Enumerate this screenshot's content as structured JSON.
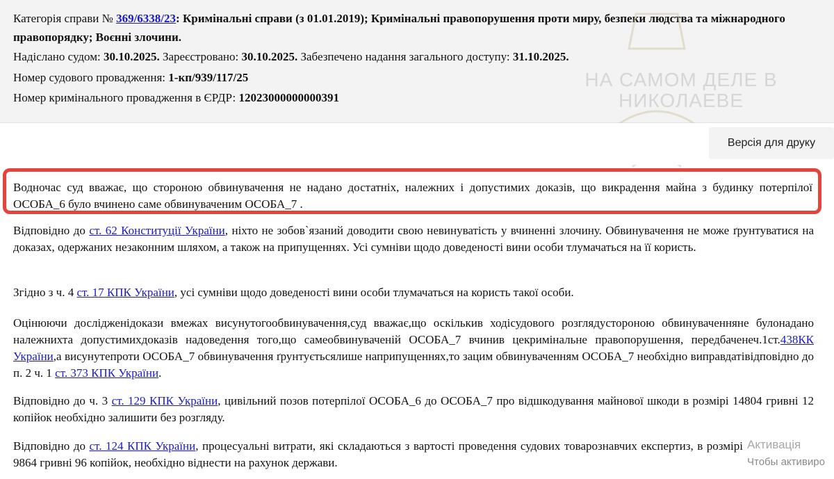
{
  "info": {
    "category_label": "Категорія справи № ",
    "case_number": "369/6338/23",
    "category_text_1": ": Кримінальні справи (з 01.01.2019); Кримінальні правопорушення проти миру, безпеки людства та міжнародного",
    "category_text_2": "правопорядку; Воєнні злочини.",
    "sent_label": "Надіслано судом: ",
    "sent_date": "30.10.2025.",
    "registered_label": " Зареєстровано: ",
    "registered_date": "30.10.2025.",
    "access_label": " Забезпечено надання загального доступу: ",
    "access_date": "31.10.2025.",
    "proceeding_label": "Номер судового провадження: ",
    "proceeding_number": "1-кп/939/117/25",
    "erdr_label": "Номер кримінального провадження в ЄРДР: ",
    "erdr_number": "12023000000000391"
  },
  "watermark": {
    "line1": "НА САМОМ ДЕЛЕ В",
    "line2": "НИКОЛАЕВЕ"
  },
  "toolbar": {
    "print_label": "Версія для друку"
  },
  "document": {
    "p1": "Водночас суд вважає, що стороною обвинувачення не надано достатніх, належних і допустимих доказів, що викрадення майна з будинку потерпілої ОСОБА_6 було вчинено саме обвинуваченим ОСОБА_7 .",
    "p2_a": "Відповідно до ",
    "p2_link": "ст. 62 Конституції України",
    "p2_b": ", ніхто не зобов`язаний доводити свою невинуватість у вчиненні злочину. Обвинувачення не може ґрунтуватися на доказах, одержаних незаконним шляхом, а також на припущеннях. Усі сумніви щодо доведеності вини особи тлумачаться на її користь.",
    "p3_a": "Згідно з ч. 4 ",
    "p3_link": "ст. 17 КПК України",
    "p3_b": ", усі сумніви щодо доведеності вини особи тлумачаться на користь такої особи.",
    "p4_a": "Оцінюючи дослідженідокази вмежах висунутогообвинувачення,суд вважає,що оскількив ходісудового розглядустороною обвинуваченняне булонадано належнихта допустимихдоказів надоведення того,що самеобвинуваченій ОСОБА_7 вчинив цекримінальне правопорушення, передбаченеч.1ст.",
    "p4_link1": "438КК України",
    "p4_b": ",а висунутепроти ОСОБА_7 обвинувачення ґрунтуєтьсялише наприпущеннях,то зацим обвинуваченням ОСОБА_7 необхідно виправдатівідповідно до п. 2 ч. 1 ",
    "p4_link2": "ст. 373 КПК України",
    "p4_c": ".",
    "p5_a": "Відповідно до ч. 3 ",
    "p5_link": "ст. 129 КПК України",
    "p5_b": ", цивільний позов потерпілої ОСОБА_6 до ОСОБА_7 про відшкодування майнової шкоди в розмірі 14804 гривні 12 копійок необхідно залишити без розгляду.",
    "p6_a": "Відповідно до ",
    "p6_link": "ст. 124 КПК України",
    "p6_b": ", процесуальні витрати, які складаються з вартості проведення судових товарознавчих експертиз, в розмірі 9864 гривні 96 копійок, необхідно віднести на рахунок держави."
  },
  "system": {
    "activation_line1": "Активація",
    "activation_line2": "Чтобы активиро"
  },
  "colors": {
    "highlight": "#e5443d",
    "link": "#1a1acc",
    "panel": "#f3f3f3"
  }
}
